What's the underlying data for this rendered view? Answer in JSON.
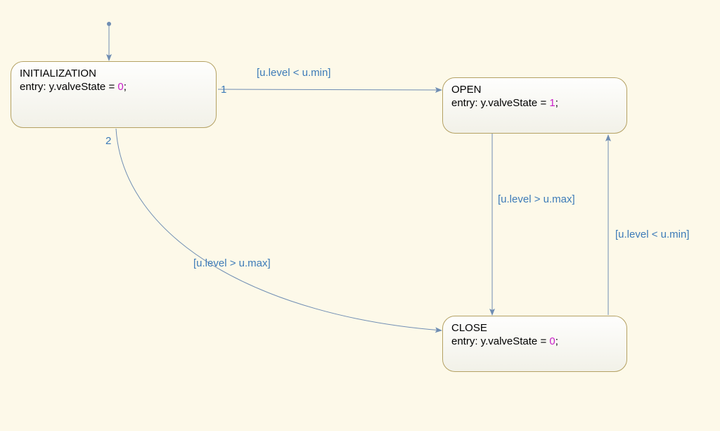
{
  "states": {
    "initialization": {
      "name": "INITIALIZATION",
      "entry_prefix": "entry: y.valveState = ",
      "entry_value": "0",
      "entry_suffix": ";"
    },
    "open": {
      "name": "OPEN",
      "entry_prefix": "entry: y.valveState = ",
      "entry_value": "1",
      "entry_suffix": ";"
    },
    "close": {
      "name": "CLOSE",
      "entry_prefix": "entry: y.valveState = ",
      "entry_value": "0",
      "entry_suffix": ";"
    }
  },
  "transitions": {
    "init_open": {
      "guard": "[u.level < u.min]",
      "priority": "1"
    },
    "init_close": {
      "guard": "[u.level > u.max]",
      "priority": "2"
    },
    "open_close": {
      "guard": "[u.level > u.max]"
    },
    "close_open": {
      "guard": "[u.level < u.min]"
    }
  },
  "colors": {
    "arrow": "#6f8db3",
    "label": "#3d7bb8",
    "border": "#b4a163",
    "bg": "#fdf9e9"
  }
}
